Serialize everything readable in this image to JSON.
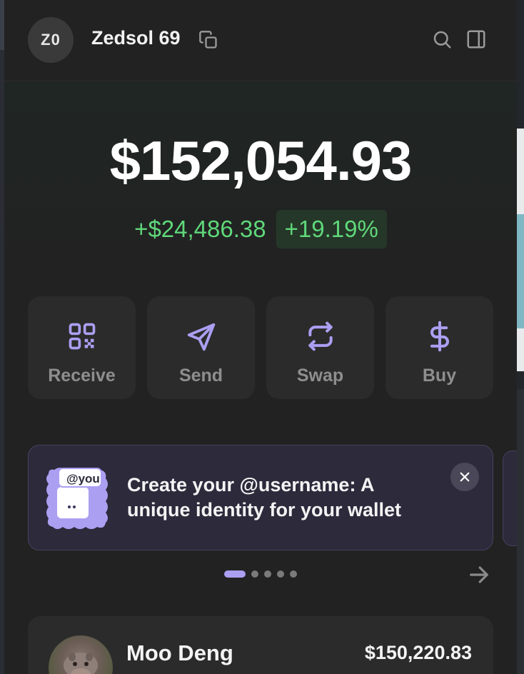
{
  "header": {
    "avatar_initials": "Z0",
    "account_name": "Zedsol 69"
  },
  "balance": {
    "total": "$152,054.93",
    "change_amount": "+$24,486.38",
    "change_percent": "+19.19%",
    "positive_color": "#5fd87a"
  },
  "actions": [
    {
      "label": "Receive",
      "icon": "qr-code-icon"
    },
    {
      "label": "Send",
      "icon": "send-icon"
    },
    {
      "label": "Swap",
      "icon": "swap-icon"
    },
    {
      "label": "Buy",
      "icon": "dollar-icon"
    }
  ],
  "accent_color": "#ab9ff2",
  "promo": {
    "badge": "@you",
    "text": "Create your @username: A unique identity for your wallet"
  },
  "carousel": {
    "total_pages": 5,
    "current_page": 1
  },
  "tokens": [
    {
      "name": "Moo Deng",
      "value": "$150,220.83"
    }
  ]
}
